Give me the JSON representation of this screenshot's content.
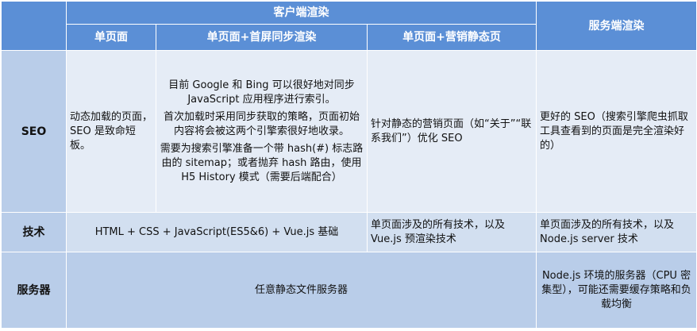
{
  "header": {
    "client": "客户端渲染",
    "server": "服务端渲染",
    "spa": "单页面",
    "spa_ssr_first": "单页面+首屏同步渲染",
    "spa_static": "单页面+营销静态页"
  },
  "rows": {
    "seo": {
      "label": "SEO",
      "spa": "动态加载的页面，SEO 是致命短板。",
      "spa_ssr_first": [
        "目前 Google 和 Bing 可以很好地对同步 JavaScript 应用程序进行索引。",
        "首次加载时采用同步获取的策略，页面初始内容将会被这两个引擎索很好地收录。",
        "需要为搜索引擎准备一个带 hash(#) 标志路由的 sitemap；或者抛弃 hash 路由，使用 H5 History 模式（需要后端配合）"
      ],
      "spa_static": "针对静态的营销页面（如“关于”“联系我们”）优化 SEO",
      "server": "更好的 SEO（搜索引擎爬虫抓取工具查看到的页面是完全渲染好的）"
    },
    "tech": {
      "label": "技术",
      "client_shared": "HTML + CSS + JavaScript(ES5&6) + Vue.js 基础",
      "spa_static": "单页面涉及的所有技术，以及 Vue.js 预渲染技术",
      "server": "单页面涉及的所有技术，以及 Node.js server 技术"
    },
    "servers": {
      "label": "服务器",
      "client_shared": "任意静态文件服务器",
      "server": "Node.js 环境的服务器（CPU 密集型），可能还需要缓存策略和负载均衡"
    }
  }
}
